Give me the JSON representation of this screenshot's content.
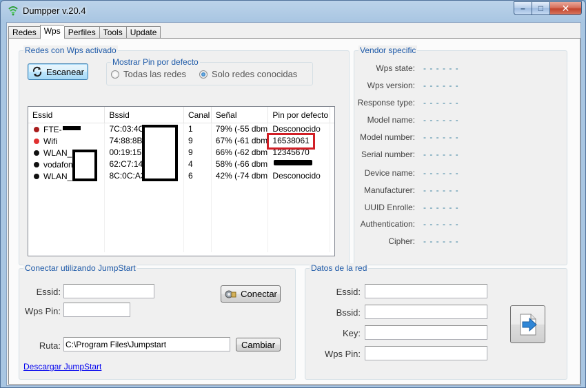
{
  "window": {
    "title": "Dumpper v.20.4",
    "minimize": "–",
    "maximize": "□",
    "close": "✕"
  },
  "tabs": [
    "Redes",
    "Wps",
    "Perfiles",
    "Tools",
    "Update"
  ],
  "wps_group": {
    "title": "Redes con Wps activado",
    "scan_button": "Escanear",
    "pin_group": {
      "title": "Mostrar Pin por defecto",
      "option_all": "Todas las redes",
      "option_known": "Solo redes conocidas",
      "selected": "Solo redes conocidas"
    },
    "columns": [
      "Essid",
      "Bssid",
      "Canal",
      "Señal",
      "Pin por defecto"
    ],
    "rows": [
      {
        "essid": "FTE-",
        "bssid": "7C:03:4C:",
        "canal": "1",
        "senal": "79% (-55 dbm)",
        "pin": "Desconocido",
        "color": "#a81c1c"
      },
      {
        "essid": "Wifi",
        "bssid": "74:88:8B:",
        "canal": "9",
        "senal": "67% (-61 dbm)",
        "pin": "16538061",
        "color": "#e03030"
      },
      {
        "essid": "WLAN_",
        "bssid": "00:19:15:",
        "canal": "9",
        "senal": "66% (-62 dbm)",
        "pin": "12345670",
        "color": "#111111"
      },
      {
        "essid": "vodafon",
        "bssid": "62:C7:14:",
        "canal": "4",
        "senal": "58% (-66 dbm)",
        "pin": "",
        "color": "#111111"
      },
      {
        "essid": "WLAN_",
        "bssid": "8C:0C:A3",
        "canal": "6",
        "senal": "42% (-74 dbm)",
        "pin": "Desconocido",
        "color": "#111111"
      }
    ]
  },
  "vendor": {
    "title": "Vendor specific",
    "fields": [
      {
        "label": "Wps state:",
        "value": "- - - - - -"
      },
      {
        "label": "Wps version:",
        "value": "- - - - - -"
      },
      {
        "label": "Response type:",
        "value": "- - - - - -"
      },
      {
        "label": "Model name:",
        "value": "- - - - - -"
      },
      {
        "label": "Model number:",
        "value": "- - - - - -"
      },
      {
        "label": "Serial number:",
        "value": "- - - - - -"
      },
      {
        "label": "Device name:",
        "value": "- - - - - -"
      },
      {
        "label": "Manufacturer:",
        "value": "- - - - - -"
      },
      {
        "label": "UUID Enrolle:",
        "value": "- - - - - -"
      },
      {
        "label": "Authentication:",
        "value": "- - - - - -"
      },
      {
        "label": "Cipher:",
        "value": "- - - - - -"
      }
    ]
  },
  "jumpstart": {
    "title": "Conectar utilizando JumpStart",
    "essid_label": "Essid:",
    "essid_value": "",
    "pin_label": "Wps Pin:",
    "pin_value": "",
    "connect_button": "Conectar",
    "ruta_label": "Ruta:",
    "ruta_value": "C:\\Program Files\\Jumpstart",
    "cambiar_button": "Cambiar",
    "download_link": "Descargar JumpStart"
  },
  "datos": {
    "title": "Datos de la red",
    "essid_label": "Essid:",
    "bssid_label": "Bssid:",
    "key_label": "Key:",
    "pin_label": "Wps Pin:",
    "essid_value": "",
    "bssid_value": "",
    "key_value": "",
    "pin_value": ""
  }
}
